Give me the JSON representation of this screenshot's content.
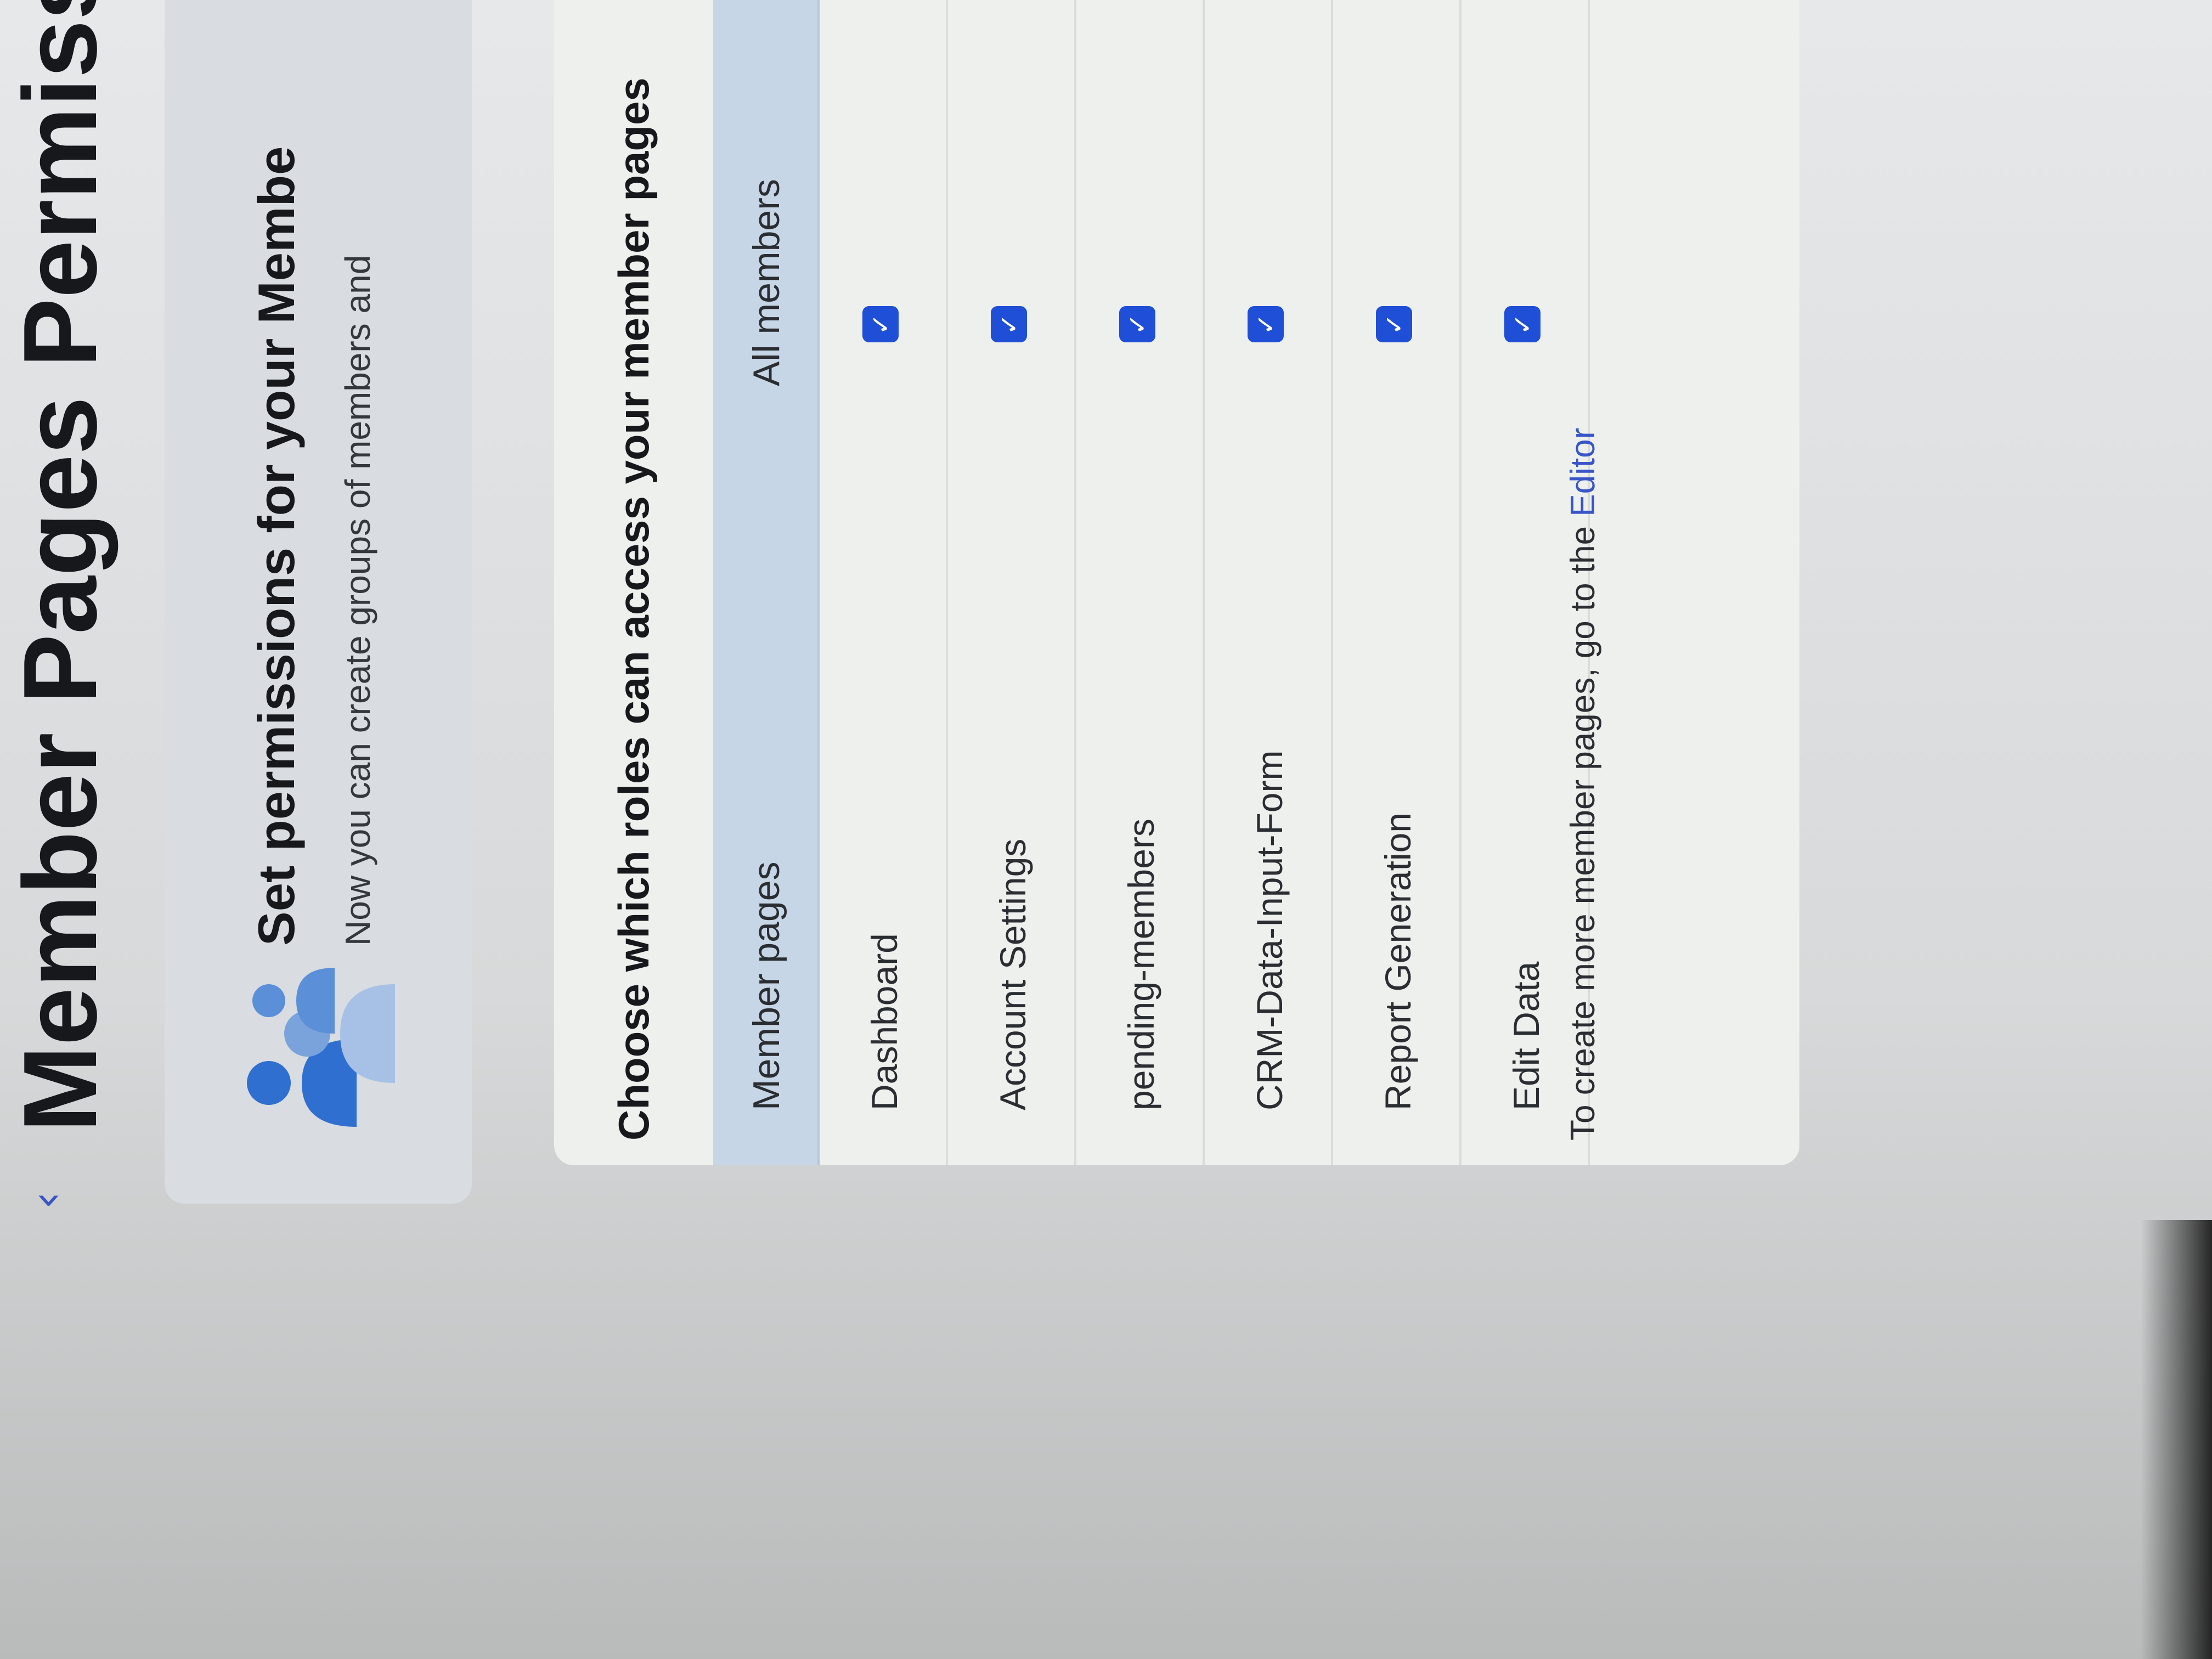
{
  "header": {
    "back_icon": "chevron-left-icon",
    "back_glyph": "‹",
    "title": "Member Pages Permissions"
  },
  "banner": {
    "illustration_icon": "members-group-icon",
    "title": "Set permissions for your Membe",
    "subtitle": "Now you can create groups of members and"
  },
  "permissions": {
    "heading": "Choose which roles can access your member pages",
    "columns": {
      "pages": "Member pages",
      "role": "All members"
    },
    "rows": [
      {
        "label": "Dashboard",
        "checked": true
      },
      {
        "label": "Account Settings",
        "checked": true
      },
      {
        "label": "pending-members",
        "checked": true
      },
      {
        "label": "CRM-Data-Input-Form",
        "checked": true
      },
      {
        "label": "Report Generation",
        "checked": true
      },
      {
        "label": "Edit Data",
        "checked": true
      }
    ],
    "check_glyph": "✓",
    "footer_text": "To create more member pages, go to the ",
    "footer_link": "Editor"
  },
  "colors": {
    "accent": "#1f4fd6",
    "link": "#3a55c7",
    "header_row": "#c7d6e6"
  }
}
